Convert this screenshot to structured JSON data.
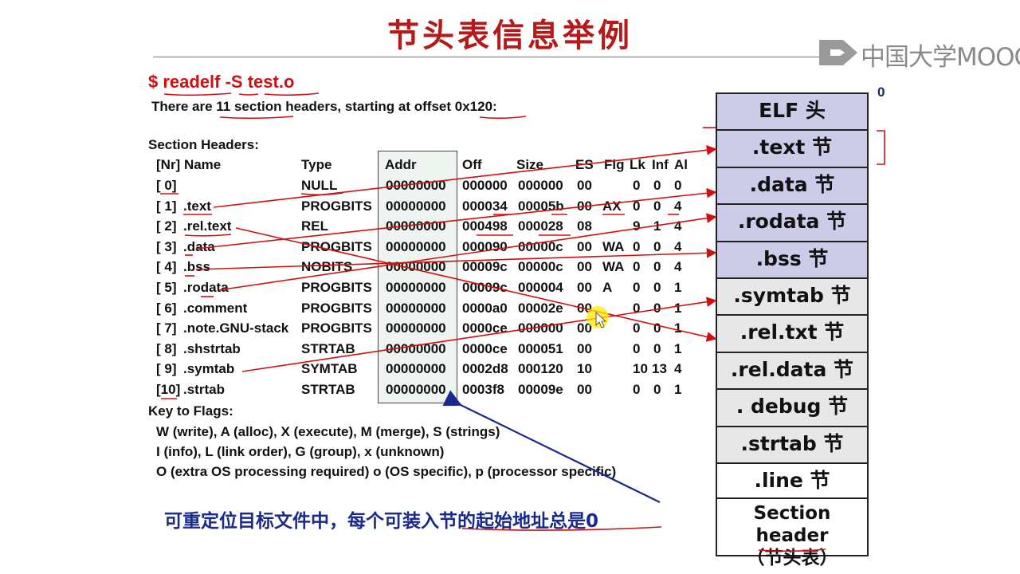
{
  "slide": {
    "title": "节头表信息举例",
    "logo": {
      "text": "中国大学MOOC",
      "icon": "mooc-logo-icon"
    },
    "command": "$ readelf -S test.o",
    "summary": "There are 11 section headers, starting at offset 0x120:",
    "section_headers_label": "Section Headers:",
    "columns": {
      "nr_name": "[Nr] Name",
      "type": "Type",
      "addr": "Addr",
      "off": "Off",
      "size": "Size",
      "es": "ES",
      "flg": "Flg",
      "lk": "Lk",
      "inf": "Inf",
      "al": "Al"
    },
    "rows": [
      {
        "nr": "[ 0]",
        "name": "",
        "type": "NULL",
        "addr": "00000000",
        "off": "000000",
        "size": "000000",
        "es": "00",
        "flg": "",
        "lk": "0",
        "inf": "0",
        "al": "0"
      },
      {
        "nr": "[ 1]",
        "name": ".text",
        "type": "PROGBITS",
        "addr": "00000000",
        "off": "000034",
        "size": "00005b",
        "es": "00",
        "flg": "AX",
        "lk": "0",
        "inf": "0",
        "al": "4"
      },
      {
        "nr": "[ 2]",
        "name": ".rel.text",
        "type": "REL",
        "addr": "00000000",
        "off": "000498",
        "size": "000028",
        "es": "08",
        "flg": "",
        "lk": "9",
        "inf": "1",
        "al": "4"
      },
      {
        "nr": "[ 3]",
        "name": ".data",
        "type": "PROGBITS",
        "addr": "00000000",
        "off": "000090",
        "size": "00000c",
        "es": "00",
        "flg": "WA",
        "lk": "0",
        "inf": "0",
        "al": "4"
      },
      {
        "nr": "[ 4]",
        "name": ".bss",
        "type": "NOBITS",
        "addr": "00000000",
        "off": "00009c",
        "size": "00000c",
        "es": "00",
        "flg": "WA",
        "lk": "0",
        "inf": "0",
        "al": "4"
      },
      {
        "nr": "[ 5]",
        "name": ".rodata",
        "type": "PROGBITS",
        "addr": "00000000",
        "off": "00009c",
        "size": "000004",
        "es": "00",
        "flg": "A",
        "lk": "0",
        "inf": "0",
        "al": "1"
      },
      {
        "nr": "[ 6]",
        "name": ".comment",
        "type": "PROGBITS",
        "addr": "00000000",
        "off": "0000a0",
        "size": "00002e",
        "es": "00",
        "flg": "",
        "lk": "0",
        "inf": "0",
        "al": "1"
      },
      {
        "nr": "[ 7]",
        "name": ".note.GNU-stack",
        "type": "PROGBITS",
        "addr": "00000000",
        "off": "0000ce",
        "size": "000000",
        "es": "00",
        "flg": "",
        "lk": "0",
        "inf": "0",
        "al": "1"
      },
      {
        "nr": "[ 8]",
        "name": ".shstrtab",
        "type": "STRTAB",
        "addr": "00000000",
        "off": "0000ce",
        "size": "000051",
        "es": "00",
        "flg": "",
        "lk": "0",
        "inf": "0",
        "al": "1"
      },
      {
        "nr": "[ 9]",
        "name": ".symtab",
        "type": "SYMTAB",
        "addr": "00000000",
        "off": "0002d8",
        "size": "000120",
        "es": "10",
        "flg": "",
        "lk": "10",
        "inf": "13",
        "al": "4"
      },
      {
        "nr": "[10]",
        "name": ".strtab",
        "type": "STRTAB",
        "addr": "00000000",
        "off": "0003f8",
        "size": "00009e",
        "es": "00",
        "flg": "",
        "lk": "0",
        "inf": "0",
        "al": "1"
      }
    ],
    "key_to_flags": {
      "label": "Key to Flags:",
      "line1": "W (write), A (alloc), X (execute), M (merge), S (strings)",
      "line2": "I (info), L (link order), G (group), x (unknown)",
      "line3": "O (extra OS processing required) o (OS specific), p (processor specific)"
    },
    "bottom_note": "可重定位目标文件中，每个可装入节的起始地址总是0",
    "elf_layout": {
      "zero_label": "0",
      "sections": [
        {
          "label": "ELF 头",
          "style": "lav"
        },
        {
          "label": ".text 节",
          "style": "lav"
        },
        {
          "label": ".data 节",
          "style": "lav"
        },
        {
          "label": ".rodata 节",
          "style": "lav"
        },
        {
          "label": ".bss 节",
          "style": "lav"
        },
        {
          "label": ".symtab 节",
          "style": "gray"
        },
        {
          "label": ".rel.txt 节",
          "style": "gray"
        },
        {
          "label": ".rel.data 节",
          "style": "gray"
        },
        {
          "label": ". debug 节",
          "style": "gray"
        },
        {
          "label": ".strtab 节",
          "style": "gray"
        },
        {
          "label": ".line 节",
          "style": "white"
        }
      ],
      "section_header": {
        "line1": "Section header",
        "line2_open": "（",
        "line2_cn": "节头表",
        "line2_close": "）"
      }
    },
    "colors": {
      "title": "#b51a1a",
      "annotation_red": "#d01010",
      "note_blue": "#1a2a8c",
      "lavender": "#cccce8",
      "gray": "#e7e7e7"
    }
  }
}
